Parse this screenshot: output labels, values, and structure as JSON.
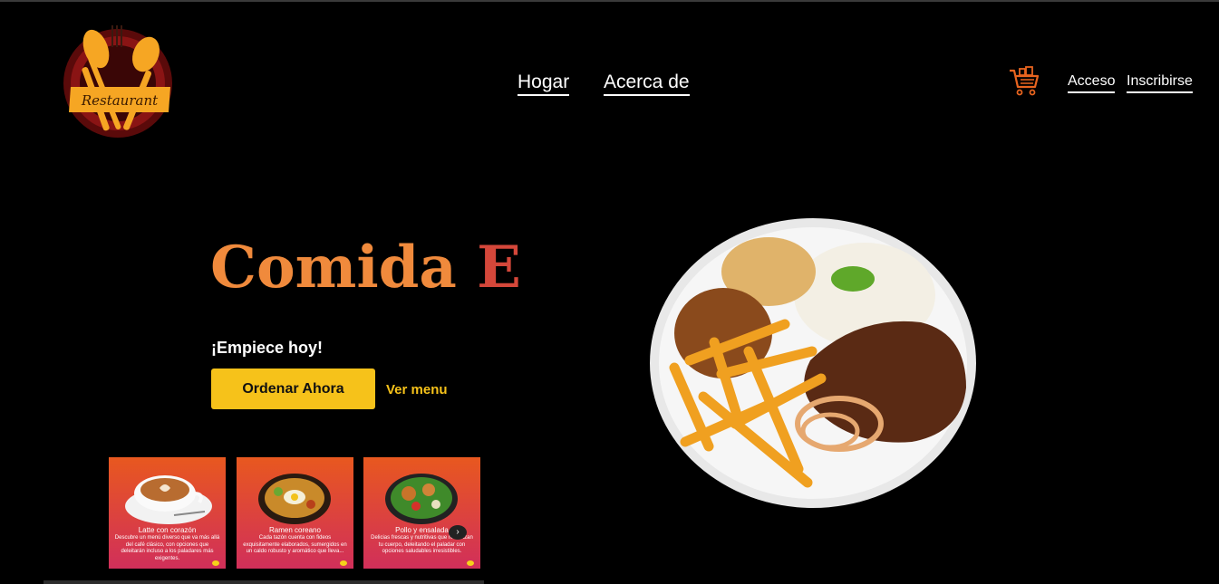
{
  "brand": {
    "logo_text": "Restaurant",
    "icon": "fork-spoon-logo-icon",
    "primary_color": "#f6a623",
    "ring_color": "#8a1414"
  },
  "nav": {
    "items": [
      {
        "label": "Hogar"
      },
      {
        "label": "Acerca de"
      }
    ]
  },
  "header_actions": {
    "cart_icon": "shopping-cart-icon",
    "cart_color": "#e8641f",
    "login_label": "Acceso",
    "signup_label": "Inscribirse"
  },
  "hero": {
    "title_part1": "Comida ",
    "title_part2": "E",
    "title_colors": [
      "#f08a3c",
      "#d4473a"
    ],
    "tagline": "¡Empiece hoy!",
    "order_button": "Ordenar Ahora",
    "menu_link": "Ver menu",
    "accent_color": "#f6c21a"
  },
  "cards": [
    {
      "title": "Latte con corazón",
      "description": "Descubre un menú diverso que va más allá del café clásico, con opciones que deleitarán incluso a los paladares más exigentes.",
      "image_icon": "latte-cup-icon"
    },
    {
      "title": "Ramen coreano",
      "description": "Cada tazón cuenta con fideos exquisitamente elaborados, sumergidos en un caldo robusto y aromático que lleva...",
      "image_icon": "ramen-bowl-icon"
    },
    {
      "title": "Pollo y ensalada",
      "description": "Delicias frescas y nutritivas que revitalizan tu cuerpo, deleitando el paladar con opciones saludables irresistibles.",
      "image_icon": "salad-bowl-icon"
    }
  ],
  "carousel": {
    "next_icon": "chevron-right-icon",
    "next_glyph": "›"
  }
}
